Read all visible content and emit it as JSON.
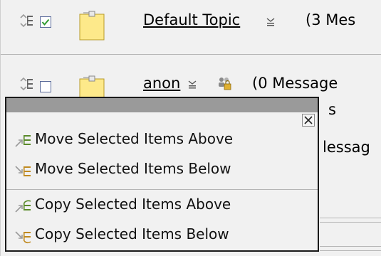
{
  "topics": [
    {
      "title": "Default Topic",
      "count_text": "(3 Mes",
      "checked": true
    },
    {
      "title": "anon",
      "count_text": "(0 Message",
      "checked": false
    }
  ],
  "background_fragments": {
    "row2_wrap": "s",
    "row3_partial": "lessag"
  },
  "context_menu": {
    "items": [
      {
        "label": "Move Selected Items Above",
        "icon": "move-above-icon"
      },
      {
        "label": "Move Selected Items Below",
        "icon": "move-below-icon"
      },
      {
        "label": "Copy Selected Items Above",
        "icon": "copy-above-icon"
      },
      {
        "label": "Copy Selected Items Below",
        "icon": "copy-below-icon"
      }
    ]
  },
  "colors": {
    "panel_bg": "#f1f1f1",
    "popup_header": "#9a9a9a",
    "note_yellow": "#fde98a",
    "check_green": "#2e9a2e"
  }
}
